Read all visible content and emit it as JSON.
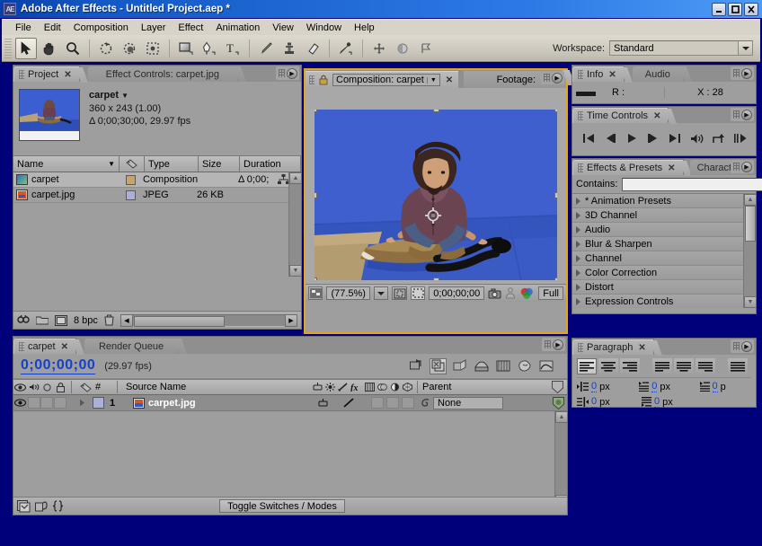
{
  "window": {
    "title": "Adobe After Effects - Untitled Project.aep *",
    "logo": "AE",
    "minimize": "_",
    "maximize": "☐",
    "close": "✕"
  },
  "menubar": {
    "items": [
      "File",
      "Edit",
      "Composition",
      "Layer",
      "Effect",
      "Animation",
      "View",
      "Window",
      "Help"
    ]
  },
  "toolbar": {
    "tools": [
      {
        "name": "selection-tool",
        "selected": true
      },
      {
        "name": "hand-tool",
        "selected": false
      },
      {
        "name": "zoom-tool",
        "selected": false
      },
      {
        "name": "rotation-tool",
        "selected": false
      },
      {
        "name": "orbit-camera-tool",
        "selected": false
      },
      {
        "name": "pan-behind-tool",
        "selected": false
      },
      {
        "name": "rectangle-mask-tool",
        "selected": false
      },
      {
        "name": "pen-tool",
        "selected": false
      },
      {
        "name": "type-tool",
        "selected": false
      },
      {
        "name": "brush-tool",
        "selected": false
      },
      {
        "name": "clone-stamp-tool",
        "selected": false
      },
      {
        "name": "eraser-tool",
        "selected": false
      },
      {
        "name": "puppet-pin-tool",
        "selected": false
      }
    ],
    "workspace_label": "Workspace:",
    "workspace_value": "Standard"
  },
  "project_panel": {
    "tabs": [
      {
        "label": "Project",
        "active": true,
        "closable": true
      },
      {
        "label": "Effect Controls: carpet.jpg",
        "active": false,
        "closable": false
      }
    ],
    "item_name": "carpet",
    "dimensions": "360 x 243 (1.00)",
    "duration_info": "Δ 0;00;30;00, 29.97 fps",
    "columns": [
      "Name",
      "Type",
      "Size",
      "Duration"
    ],
    "rows": [
      {
        "name": "carpet",
        "type": "Composition",
        "size": "",
        "duration": "Δ 0;00;",
        "selected": true
      },
      {
        "name": "carpet.jpg",
        "type": "JPEG",
        "size": "26 KB",
        "duration": "",
        "selected": false
      }
    ],
    "footer": {
      "bit_depth": "8 bpc",
      "icons": [
        "search-icon",
        "new-folder-icon",
        "new-comp-icon",
        "delete-icon"
      ]
    }
  },
  "comp_panel": {
    "tab_label": "Composition: carpet",
    "tab_close": "✕",
    "footer_tab_label": "Footage:",
    "zoom": "(77.5%)",
    "timecode": "0;00;00;00",
    "resolution": "Full",
    "icons": [
      "toggle-transparency-icon",
      "region-of-interest-icon",
      "take-snapshot-icon",
      "show-snapshot-icon",
      "show-channel-icon"
    ]
  },
  "info_panel": {
    "tabs": [
      {
        "label": "Info",
        "active": true,
        "closable": true
      },
      {
        "label": "Audio",
        "active": false,
        "closable": false
      }
    ],
    "red_label": "R :",
    "x_label": "X : 28"
  },
  "time_controls": {
    "tab": "Time Controls",
    "buttons": [
      "first-frame-icon",
      "previous-frame-icon",
      "play-icon",
      "next-frame-icon",
      "last-frame-icon",
      "audio-icon",
      "loop-icon",
      "ram-preview-icon"
    ]
  },
  "effects_panel": {
    "tabs": [
      {
        "label": "Effects & Presets",
        "active": true,
        "closable": true
      },
      {
        "label": "Charact",
        "active": false,
        "closable": false
      }
    ],
    "contains_label": "Contains:",
    "contains_value": "",
    "categories": [
      "* Animation Presets",
      "3D Channel",
      "Audio",
      "Blur & Sharpen",
      "Channel",
      "Color Correction",
      "Distort",
      "Expression Controls"
    ]
  },
  "paragraph_panel": {
    "tab": "Paragraph",
    "align_buttons": [
      {
        "name": "align-left",
        "selected": true
      },
      {
        "name": "align-center",
        "selected": false
      },
      {
        "name": "align-right",
        "selected": false
      },
      {
        "name": "justify-last-left",
        "selected": false
      },
      {
        "name": "justify-last-center",
        "selected": false
      },
      {
        "name": "justify-last-right",
        "selected": false
      },
      {
        "name": "justify-all",
        "selected": false
      }
    ],
    "indents": [
      {
        "name": "indent-left-margin",
        "value": "0",
        "unit": "px"
      },
      {
        "name": "indent-first-line",
        "value": "0",
        "unit": "px"
      },
      {
        "name": "space-before-paragraph",
        "value": "0",
        "unit": "p"
      },
      {
        "name": "indent-right-margin",
        "value": "0",
        "unit": "px"
      },
      {
        "name": "space-after-paragraph",
        "value": "0",
        "unit": "px"
      }
    ]
  },
  "timeline": {
    "tabs": [
      {
        "label": "carpet",
        "active": true,
        "closable": true
      },
      {
        "label": "Render Queue",
        "active": false,
        "closable": false
      }
    ],
    "current_time": "0;00;00;00",
    "fps": "(29.97 fps)",
    "toolbar_icons": [
      "live-update-icon",
      "draft-3d-icon",
      "hide-shy-icon",
      "frame-blending-icon",
      "motion-blur-icon",
      "brainstorm-icon",
      "graph-editor-icon"
    ],
    "columns": {
      "eye": "eye-icon",
      "audio": "speaker-icon",
      "solo": "solo-icon",
      "lock": "lock-icon",
      "label": "label-icon",
      "number": "#",
      "source_name": "Source Name",
      "switches": [
        "shy-icon",
        "collapse-icon",
        "quality-icon",
        "effects-icon",
        "frame-blend-icon",
        "motion-blur-icon",
        "adjustment-icon",
        "3d-layer-icon"
      ],
      "parent": "Parent"
    },
    "layers": [
      {
        "index": "1",
        "name": "carpet.jpg",
        "parent": "None",
        "visible": true
      }
    ],
    "toggle_button": "Toggle Switches / Modes",
    "footer_icons": [
      "comp-flowchart-icon",
      "comp-mini-icon",
      "expression-icon"
    ]
  }
}
